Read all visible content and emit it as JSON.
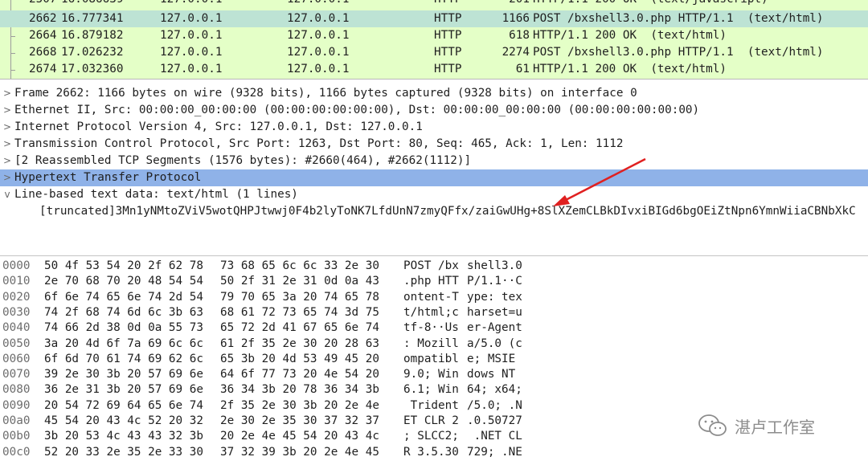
{
  "packet_list": {
    "rows": [
      {
        "no": "2507",
        "time": "16.086639",
        "src": "127.0.0.1",
        "dst": "127.0.0.1",
        "proto": "HTTP",
        "len": "201",
        "info": "HTTP/1.1 200 OK  (text/javascript)"
      },
      {
        "no": "2662",
        "time": "16.777341",
        "src": "127.0.0.1",
        "dst": "127.0.0.1",
        "proto": "HTTP",
        "len": "1166",
        "info": "POST /bxshell3.0.php HTTP/1.1  (text/html)"
      },
      {
        "no": "2664",
        "time": "16.879182",
        "src": "127.0.0.1",
        "dst": "127.0.0.1",
        "proto": "HTTP",
        "len": "618",
        "info": "HTTP/1.1 200 OK  (text/html)"
      },
      {
        "no": "2668",
        "time": "17.026232",
        "src": "127.0.0.1",
        "dst": "127.0.0.1",
        "proto": "HTTP",
        "len": "2274",
        "info": "POST /bxshell3.0.php HTTP/1.1  (text/html)"
      },
      {
        "no": "2674",
        "time": "17.032360",
        "src": "127.0.0.1",
        "dst": "127.0.0.1",
        "proto": "HTTP",
        "len": "61",
        "info": "HTTP/1.1 200 OK  (text/html)"
      }
    ]
  },
  "details": {
    "items": [
      {
        "arrow": ">",
        "text": "Frame 2662: 1166 bytes on wire (9328 bits), 1166 bytes captured (9328 bits) on interface 0"
      },
      {
        "arrow": ">",
        "text": "Ethernet II, Src: 00:00:00_00:00:00 (00:00:00:00:00:00), Dst: 00:00:00_00:00:00 (00:00:00:00:00:00)"
      },
      {
        "arrow": ">",
        "text": "Internet Protocol Version 4, Src: 127.0.0.1, Dst: 127.0.0.1"
      },
      {
        "arrow": ">",
        "text": "Transmission Control Protocol, Src Port: 1263, Dst Port: 80, Seq: 465, Ack: 1, Len: 1112"
      },
      {
        "arrow": ">",
        "text": "[2 Reassembled TCP Segments (1576 bytes): #2660(464), #2662(1112)]"
      },
      {
        "arrow": ">",
        "text": "Hypertext Transfer Protocol"
      },
      {
        "arrow": "v",
        "text": "Line-based text data: text/html (1 lines)"
      }
    ],
    "subline": "[truncated]3Mn1yNMtoZViV5wotQHPJtwwj0F4b2lyToNK7LfdUnN7zmyQFfx/zaiGwUHg+8SlXZemCLBkDIvxiBIGd6bgOEiZtNpn6YmnWiiaCBNbXkC"
  },
  "bytes": {
    "rows": [
      {
        "off": "0000",
        "hex1": "50 4f 53 54 20 2f 62 78",
        "hex2": "73 68 65 6c 6c 33 2e 30",
        "asc1": "POST /bx",
        "asc2": "shell3.0"
      },
      {
        "off": "0010",
        "hex1": "2e 70 68 70 20 48 54 54",
        "hex2": "50 2f 31 2e 31 0d 0a 43",
        "asc1": ".php HTT",
        "asc2": "P/1.1··C"
      },
      {
        "off": "0020",
        "hex1": "6f 6e 74 65 6e 74 2d 54",
        "hex2": "79 70 65 3a 20 74 65 78",
        "asc1": "ontent-T",
        "asc2": "ype: tex"
      },
      {
        "off": "0030",
        "hex1": "74 2f 68 74 6d 6c 3b 63",
        "hex2": "68 61 72 73 65 74 3d 75",
        "asc1": "t/html;c",
        "asc2": "harset=u"
      },
      {
        "off": "0040",
        "hex1": "74 66 2d 38 0d 0a 55 73",
        "hex2": "65 72 2d 41 67 65 6e 74",
        "asc1": "tf-8··Us",
        "asc2": "er-Agent"
      },
      {
        "off": "0050",
        "hex1": "3a 20 4d 6f 7a 69 6c 6c",
        "hex2": "61 2f 35 2e 30 20 28 63",
        "asc1": ": Mozill",
        "asc2": "a/5.0 (c"
      },
      {
        "off": "0060",
        "hex1": "6f 6d 70 61 74 69 62 6c",
        "hex2": "65 3b 20 4d 53 49 45 20",
        "asc1": "ompatibl",
        "asc2": "e; MSIE "
      },
      {
        "off": "0070",
        "hex1": "39 2e 30 3b 20 57 69 6e",
        "hex2": "64 6f 77 73 20 4e 54 20",
        "asc1": "9.0; Win",
        "asc2": "dows NT "
      },
      {
        "off": "0080",
        "hex1": "36 2e 31 3b 20 57 69 6e",
        "hex2": "36 34 3b 20 78 36 34 3b",
        "asc1": "6.1; Win",
        "asc2": "64; x64;"
      },
      {
        "off": "0090",
        "hex1": "20 54 72 69 64 65 6e 74",
        "hex2": "2f 35 2e 30 3b 20 2e 4e",
        "asc1": " Trident",
        "asc2": "/5.0; .N"
      },
      {
        "off": "00a0",
        "hex1": "45 54 20 43 4c 52 20 32",
        "hex2": "2e 30 2e 35 30 37 32 37",
        "asc1": "ET CLR 2",
        "asc2": ".0.50727"
      },
      {
        "off": "00b0",
        "hex1": "3b 20 53 4c 43 43 32 3b",
        "hex2": "20 2e 4e 45 54 20 43 4c",
        "asc1": "; SLCC2;",
        "asc2": " .NET CL"
      },
      {
        "off": "00c0",
        "hex1": "52 20 33 2e 35 2e 33 30",
        "hex2": "37 32 39 3b 20 2e 4e 45",
        "asc1": "R 3.5.30",
        "asc2": "729; .NE"
      }
    ]
  },
  "watermark": {
    "text": "湛卢工作室",
    "icon": "wechat-icon"
  },
  "colors": {
    "http_row_bg": "#e4ffc7",
    "selected_packet_bg": "#bde3d4",
    "selected_detail_bg": "#8fb2e8",
    "annotation": "#e02020"
  }
}
